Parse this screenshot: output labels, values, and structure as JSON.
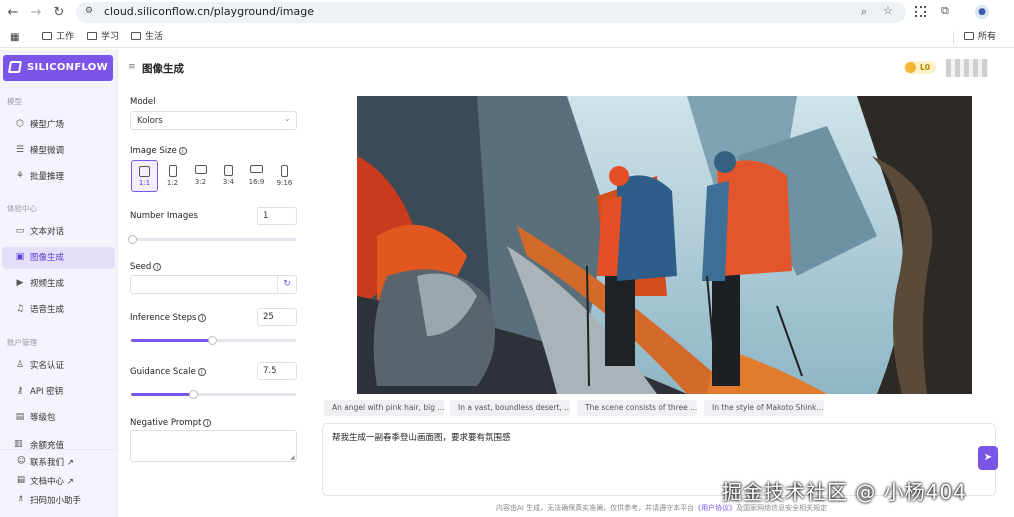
{
  "browser": {
    "url": "cloud.siliconflow.cn/playground/image",
    "bookmarks": [
      "工作",
      "学习",
      "生活"
    ],
    "bookmark_right": "所有"
  },
  "sidebar": {
    "logo": "SILICONFLOW",
    "sections": [
      {
        "title": "模型",
        "items": [
          {
            "label": "模型广场",
            "icon": "cube-icon"
          },
          {
            "label": "模型微调",
            "icon": "sliders-icon"
          },
          {
            "label": "批量推理",
            "icon": "batch-icon"
          }
        ]
      },
      {
        "title": "体验中心",
        "items": [
          {
            "label": "文本对话",
            "icon": "chat-icon"
          },
          {
            "label": "图像生成",
            "icon": "image-icon",
            "active": true
          },
          {
            "label": "视频生成",
            "icon": "video-icon"
          },
          {
            "label": "语音生成",
            "icon": "mic-icon"
          }
        ]
      },
      {
        "title": "账户管理",
        "items": [
          {
            "label": "实名认证",
            "icon": "user-check-icon"
          },
          {
            "label": "API 密钥",
            "icon": "key-icon"
          },
          {
            "label": "等级包",
            "icon": "package-icon"
          },
          {
            "label": "余额充值",
            "icon": "wallet-icon"
          }
        ]
      }
    ],
    "footer": [
      {
        "label": "联系我们 ↗",
        "icon": "smile-icon"
      },
      {
        "label": "文档中心 ↗",
        "icon": "doc-icon"
      },
      {
        "label": "扫码加小助手",
        "icon": "qr-user-icon"
      }
    ]
  },
  "header": {
    "title": "图像生成",
    "level": "L0"
  },
  "params": {
    "model_label": "Model",
    "model_value": "Kolors",
    "image_size_label": "Image Size",
    "sizes": [
      "1:1",
      "1:2",
      "3:2",
      "3:4",
      "16:9",
      "9:16"
    ],
    "selected_size": "1:1",
    "number_images_label": "Number Images",
    "number_images_value": "1",
    "seed_label": "Seed",
    "seed_value": "",
    "inference_steps_label": "Inference Steps",
    "inference_steps_value": "25",
    "guidance_scale_label": "Guidance Scale",
    "guidance_scale_value": "7.5",
    "negative_prompt_label": "Negative Prompt"
  },
  "result": {
    "suggestions": [
      "An angel with pink hair, big ...",
      "In a vast, boundless desert, ...",
      "The scene consists of three ...",
      "In the style of Makoto Shink..."
    ],
    "prompt": "帮我生成一副春季登山画面图，要求要有氛围感",
    "disclaimer_pre": "内容由AI 生成，无法确保真实准确，仅供参考，并请遵守本平台",
    "disclaimer_link": "《用户协议》",
    "disclaimer_post": "及国家网络信息安全相关规定"
  },
  "watermark": "掘金技术社区 @ 小杨404",
  "colors": {
    "accent": "#7b55e8",
    "sidebar_bg": "#f4f3fb",
    "active_bg": "#e5def9"
  }
}
